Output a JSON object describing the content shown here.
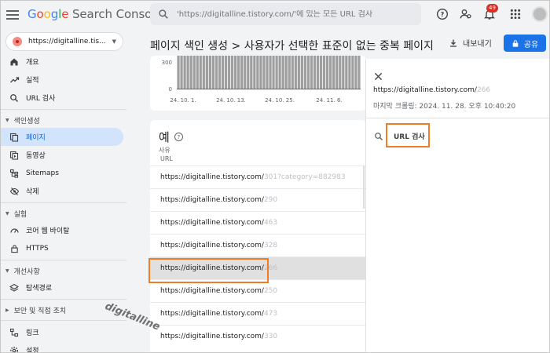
{
  "app": {
    "logo_google": "Google",
    "logo_rest": "Search Console"
  },
  "search": {
    "placeholder": "'https://digitalline.tistory.com/'에 있는 모든 URL 검사"
  },
  "notifications": {
    "count": "49"
  },
  "property": {
    "name": "https://digitalline.tis..."
  },
  "sidebar": {
    "items_top": [
      {
        "label": "개요",
        "icon": "home-icon"
      },
      {
        "label": "실적",
        "icon": "trending-up-icon"
      },
      {
        "label": "URL 검사",
        "icon": "search-icon"
      }
    ],
    "section_indexing": "색인생성",
    "items_indexing": [
      {
        "label": "페이지",
        "icon": "pages-icon",
        "active": true
      },
      {
        "label": "동영상",
        "icon": "video-pages-icon"
      },
      {
        "label": "Sitemaps",
        "icon": "sitemap-icon"
      },
      {
        "label": "삭제",
        "icon": "eye-off-icon"
      }
    ],
    "section_experience": "실험",
    "items_experience": [
      {
        "label": "코어 웹 바이탈",
        "icon": "speed-icon"
      },
      {
        "label": "HTTPS",
        "icon": "lock-icon"
      }
    ],
    "section_enhancements": "개선사항",
    "items_enhancements": [
      {
        "label": "탐색경로",
        "icon": "layers-icon"
      }
    ],
    "section_security": "보안 및 직접 조치",
    "items_bottom": [
      {
        "label": "링크",
        "icon": "links-icon"
      },
      {
        "label": "설정",
        "icon": "settings-icon"
      }
    ]
  },
  "header": {
    "title": "페이지 색인 생성  >  사용자가 선택한 표준이 없는 중복 페이지",
    "export_label": "내보내기",
    "share_label": "공유"
  },
  "chart_data": {
    "type": "bar",
    "yticks": [
      "300",
      "0"
    ],
    "xticks": [
      "24. 10. 1.",
      "24. 10. 13.",
      "24. 10. 25.",
      "24. 11. 6."
    ],
    "ylim": [
      0,
      300
    ],
    "bar_color": "#9e9e9e"
  },
  "table": {
    "title": "예",
    "subtitle": "사유",
    "column": "URL",
    "rows": [
      {
        "url": "https://digitalline.tistory.com/",
        "faint": "301?category=882983"
      },
      {
        "url": "https://digitalline.tistory.com/",
        "faint": "290"
      },
      {
        "url": "https://digitalline.tistory.com/",
        "faint": "463"
      },
      {
        "url": "https://digitalline.tistory.com/",
        "faint": "328"
      },
      {
        "url": "https://digitalline.tistory.com/",
        "faint": "266"
      },
      {
        "url": "https://digitalline.tistory.com/",
        "faint": "250"
      },
      {
        "url": "https://digitalline.tistory.com/",
        "faint": "473"
      },
      {
        "url": "https://digitalline.tistory.com/",
        "faint": "330"
      }
    ]
  },
  "watermark": "digitalline",
  "panel": {
    "url": "https://digitalline.tistory.com/",
    "url_faint": "266",
    "last_crawl": "마지막 크롤링: 2024. 11. 28. 오후 10:40:20",
    "inspect_label": "URL 검사"
  },
  "colors": {
    "accent": "#1a73e8",
    "active_bg": "#d2e3fc",
    "highlight": "#f07c28"
  }
}
